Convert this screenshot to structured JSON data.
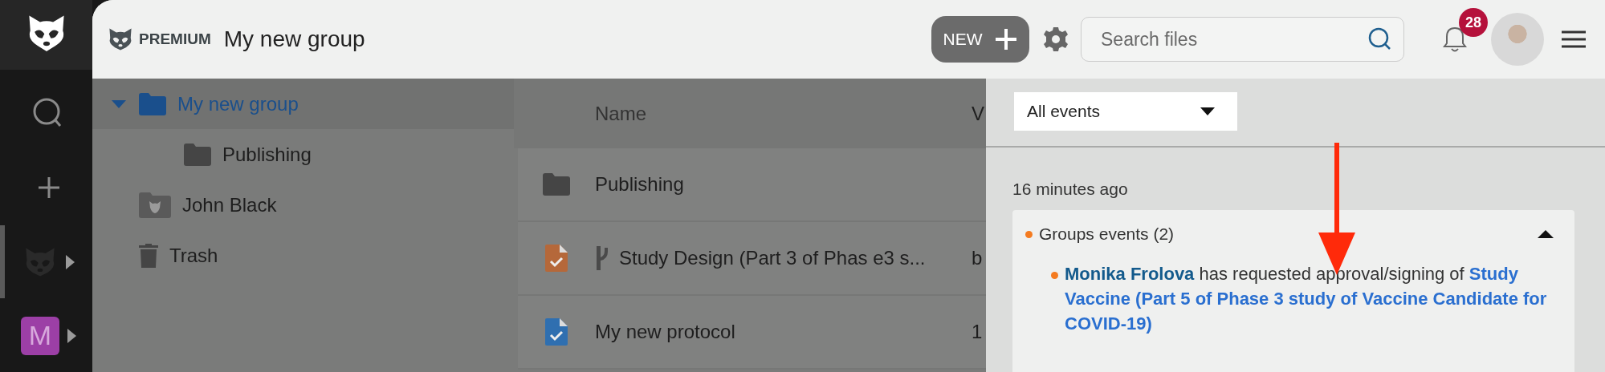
{
  "rail": {
    "items": [
      {
        "kind": "search",
        "selected": false
      },
      {
        "kind": "add",
        "selected": false
      },
      {
        "kind": "workspace",
        "selected": true
      },
      {
        "kind": "avatar",
        "label": "M",
        "selected": false
      }
    ]
  },
  "header": {
    "plan": "PREMIUM",
    "title": "My new group",
    "new_button": "NEW",
    "search": {
      "placeholder": "Search files"
    },
    "notifications": "28"
  },
  "tree": {
    "items": [
      {
        "kind": "group",
        "label": "My new group",
        "selected": true,
        "expanded": true,
        "children": [
          {
            "kind": "folder",
            "label": "Publishing",
            "selected": false
          }
        ]
      },
      {
        "kind": "user",
        "label": "John Black",
        "selected": false
      },
      {
        "kind": "trash",
        "label": "Trash",
        "selected": false
      }
    ]
  },
  "files": {
    "columns": [
      "Name",
      "V"
    ],
    "rows": [
      {
        "kind": "folder",
        "name": "Publishing"
      },
      {
        "kind": "document",
        "name": "Study Design (Part 3 of Phas e3 s...",
        "column_2": "b",
        "color": "#b5683a",
        "pinned": true
      },
      {
        "kind": "document",
        "name": "My new protocol",
        "column_2": "1",
        "color": "#2f6fb0",
        "pinned": false
      }
    ]
  },
  "events": {
    "filter": "All events",
    "groups": [
      {
        "time": "16 minutes ago",
        "title": "Groups events (2)",
        "expanded": true,
        "items": [
          {
            "actor": "Monika Frolova",
            "action": "has requested approval/signing of",
            "target": "Study Vaccine (Part 5 of Phase 3 study of Vaccine Candidate for COVID-19)"
          }
        ]
      }
    ]
  }
}
